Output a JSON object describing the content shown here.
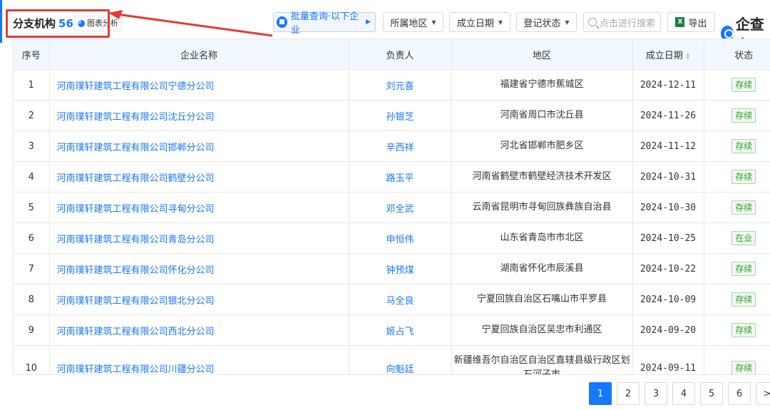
{
  "header": {
    "title": "分支机构",
    "count": "56",
    "chart_link": "图表分析",
    "batch_button": "批量查询·以下企业",
    "filters": [
      {
        "label": "所属地区"
      },
      {
        "label": "成立日期"
      },
      {
        "label": "登记状态"
      }
    ],
    "search_placeholder": "点击进行搜索",
    "export_label": "导出",
    "logo_text": "企查查"
  },
  "colors": {
    "accent": "#1677ff",
    "highlight": "#e53935",
    "status_green": "#2e9d2b"
  },
  "table": {
    "columns": [
      "序号",
      "企业名称",
      "负责人",
      "地区",
      "成立日期",
      "状态"
    ],
    "rows": [
      {
        "no": "1",
        "company": "河南璞轩建筑工程有限公司宁德分公司",
        "person": "刘元喜",
        "region": "福建省宁德市蕉城区",
        "date": "2024-12-11",
        "status": "存续"
      },
      {
        "no": "2",
        "company": "河南璞轩建筑工程有限公司沈丘分公司",
        "person": "孙银芝",
        "region": "河南省周口市沈丘县",
        "date": "2024-11-26",
        "status": "存续"
      },
      {
        "no": "3",
        "company": "河南璞轩建筑工程有限公司邯郸分公司",
        "person": "辛西祥",
        "region": "河北省邯郸市肥乡区",
        "date": "2024-11-12",
        "status": "存续"
      },
      {
        "no": "4",
        "company": "河南璞轩建筑工程有限公司鹤壁分公司",
        "person": "路玉平",
        "region": "河南省鹤壁市鹤壁经济技术开发区",
        "date": "2024-10-31",
        "status": "存续"
      },
      {
        "no": "5",
        "company": "河南璞轩建筑工程有限公司寻甸分公司",
        "person": "邓全武",
        "region": "云南省昆明市寻甸回族彝族自治县",
        "date": "2024-10-30",
        "status": "存续"
      },
      {
        "no": "6",
        "company": "河南璞轩建筑工程有限公司青岛分公司",
        "person": "申恒伟",
        "region": "山东省青岛市市北区",
        "date": "2024-10-25",
        "status": "在业"
      },
      {
        "no": "7",
        "company": "河南璞轩建筑工程有限公司怀化分公司",
        "person": "钟预煤",
        "region": "湖南省怀化市辰溪县",
        "date": "2024-10-22",
        "status": "存续"
      },
      {
        "no": "8",
        "company": "河南璞轩建筑工程有限公司银北分公司",
        "person": "马全良",
        "region": "宁夏回族自治区石嘴山市平罗县",
        "date": "2024-10-09",
        "status": "存续"
      },
      {
        "no": "9",
        "company": "河南璞轩建筑工程有限公司西北分公司",
        "person": "姬占飞",
        "region": "宁夏回族自治区吴忠市利通区",
        "date": "2024-09-20",
        "status": "存续"
      },
      {
        "no": "10",
        "company": "河南璞轩建筑工程有限公司川疆分公司",
        "person": "向魁廷",
        "region": "新疆维吾尔自治区自治区直辖县级行政区划石河子市",
        "date": "2024-09-11",
        "status": "存续"
      }
    ]
  },
  "pagination": {
    "pages": [
      "1",
      "2",
      "3",
      "4",
      "5",
      "6"
    ],
    "current": "1",
    "next": ">"
  }
}
